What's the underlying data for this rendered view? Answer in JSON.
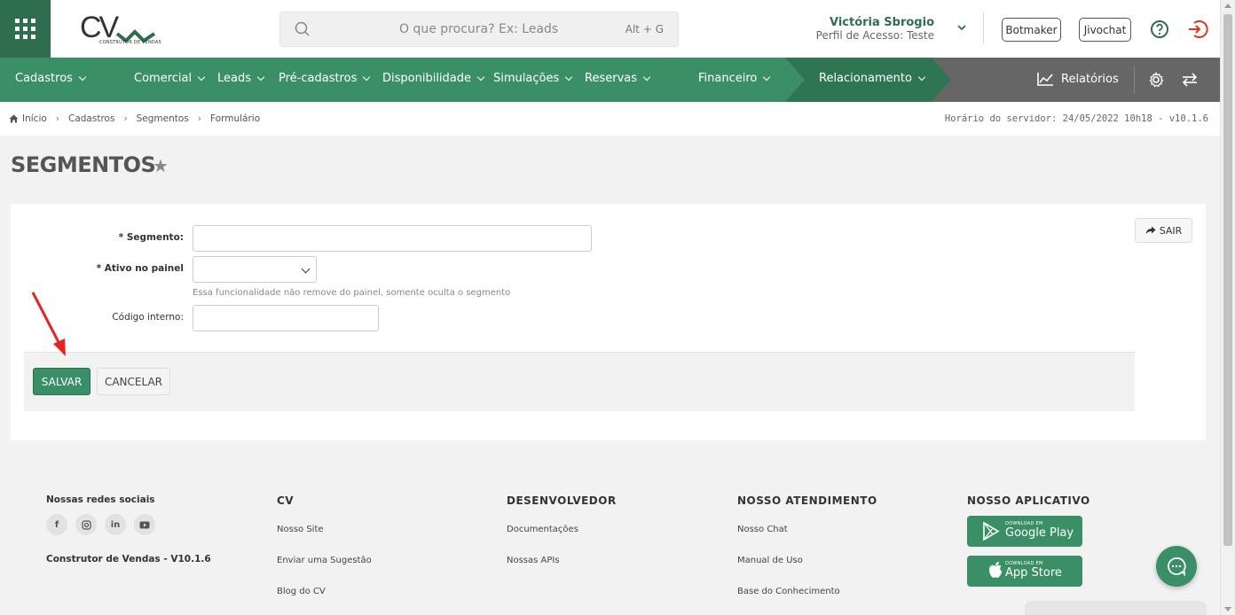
{
  "header": {
    "logo_text": "CV",
    "logo_subtitle": "CONSTRUTOR DE VENDAS",
    "search_placeholder": "O que procura? Ex: Leads",
    "search_shortcut": "Alt + G",
    "user_name": "Victória Sbrogio",
    "user_profile": "Perfil de Acesso: Teste",
    "botmaker_label": "Botmaker",
    "jivochat_label": "Jivochat"
  },
  "nav": {
    "items": [
      "Cadastros",
      "Comercial",
      "Leads",
      "Pré-cadastros",
      "Disponibilidade",
      "Simulações",
      "Reservas",
      "Financeiro",
      "Relacionamento"
    ],
    "reports_label": "Relatórios"
  },
  "breadcrumb": {
    "items": [
      "Início",
      "Cadastros",
      "Segmentos",
      "Formulário"
    ],
    "server_time": "Horário do servidor: 24/05/2022 10h18 - v10.1.6"
  },
  "page": {
    "title": "SEGMENTOS"
  },
  "form": {
    "segment_label": "* Segmento:",
    "segment_value": "",
    "active_label": "* Ativo no painel",
    "active_value": "",
    "active_hint": "Essa funcionalidade não remove do painel, somente oculta o segmento",
    "code_label": "Código interno:",
    "code_value": "",
    "exit_label": "SAIR",
    "save_label": "SALVAR",
    "cancel_label": "CANCELAR"
  },
  "footer": {
    "social_title": "Nossas redes sociais",
    "version": "Construtor de Vendas - V10.1.6",
    "cv_title": "CV",
    "cv_links": [
      "Nosso Site",
      "Enviar uma Sugestão",
      "Blog do CV"
    ],
    "dev_title": "DESENVOLVEDOR",
    "dev_links": [
      "Documentações",
      "Nossas APIs"
    ],
    "support_title": "NOSSO ATENDIMENTO",
    "support_links": [
      "Nosso Chat",
      "Manual de Uso",
      "Base do Conhecimento"
    ],
    "app_title": "NOSSO APLICATIVO",
    "google_small": "DOWNLOAD EM",
    "google_big": "Google Play",
    "apple_small": "DOWNLOAD EM",
    "apple_big": "App Store"
  },
  "colors": {
    "brand_green": "#2e6e4e",
    "button_green": "#3a8f66",
    "logout_red": "#d9381e"
  }
}
